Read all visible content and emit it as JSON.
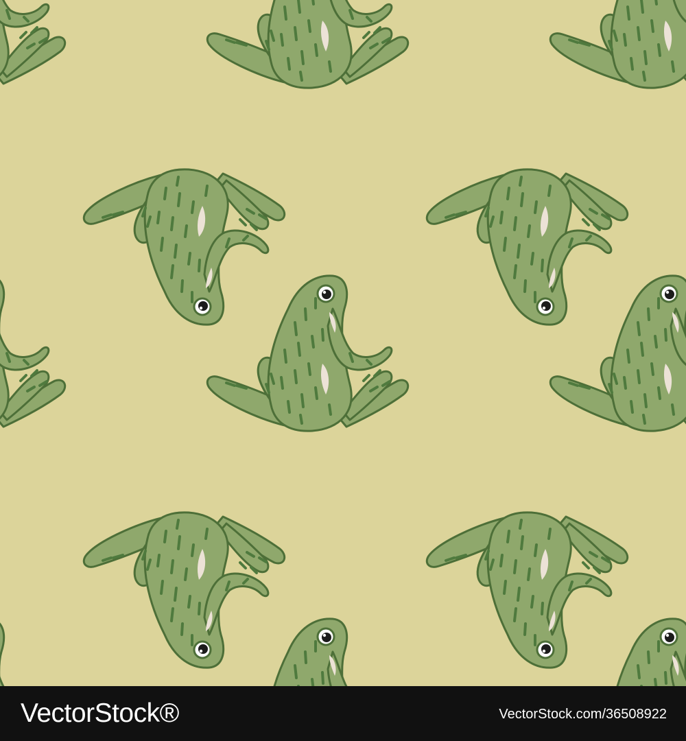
{
  "image": {
    "description_tag": "seamless-frog-pattern",
    "colors": {
      "background": "#dcd49a",
      "frog_body": "#8fa86c",
      "frog_outline": "#4d6f38",
      "frog_spots": "#4f7a3e",
      "belly_highlight": "#ece2d6",
      "eye_white": "#ffffff",
      "eye_pupil": "#1c1c1c",
      "footer_background": "#111111",
      "footer_text": "#ffffff"
    }
  },
  "watermark": {
    "brand": "VectorStock®",
    "image_id": "VectorStock.com/36508922"
  }
}
